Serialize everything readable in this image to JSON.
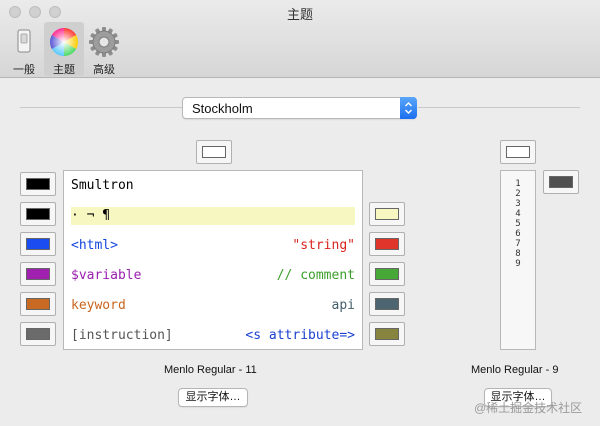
{
  "window": {
    "title": "主题"
  },
  "toolbar": {
    "items": [
      {
        "label": "一般",
        "icon": "switch-icon"
      },
      {
        "label": "主题",
        "icon": "color-wheel-icon"
      },
      {
        "label": "高级",
        "icon": "gear-icon"
      }
    ],
    "selected": "主题"
  },
  "theme": {
    "selected": "Stockholm"
  },
  "preview": {
    "lines": [
      {
        "left": "Smultron",
        "right": "",
        "left_color": "#000000",
        "right_color": "#000000"
      },
      {
        "left": "·  ¬  ¶",
        "right": "",
        "left_color": "#000000",
        "right_color": "#000000"
      },
      {
        "left": "<html>",
        "right": "\"string\"",
        "left_color": "#1447e0",
        "right_color": "#d9231f"
      },
      {
        "left": "$variable",
        "right": "// comment",
        "left_color": "#9a1fae",
        "right_color": "#3b9e2a"
      },
      {
        "left": "keyword",
        "right": "api",
        "left_color": "#c9651f",
        "right_color": "#44606b"
      },
      {
        "left": "[instruction]",
        "right": "<s attribute=>",
        "left_color": "#555555",
        "right_color": "#1a3fd0"
      }
    ],
    "highlight_color": "#f7f7c1"
  },
  "colors": {
    "left_wells": [
      "#000000",
      "#000000",
      "#1b4cf2",
      "#a020b0",
      "#c96a22",
      "#6b6b6b"
    ],
    "right_wells": [
      "#f7f7c1",
      "#e0352b",
      "#48a837",
      "#4c6570",
      "#86843e"
    ],
    "top_well": "#ffffff",
    "gutter_top_well": "#ffffff",
    "gutter_right_well": "#505050"
  },
  "editor_font": {
    "label": "Menlo Regular - 11",
    "button": "显示字体…"
  },
  "gutter": {
    "numbers": [
      "1",
      "2",
      "3",
      "4",
      "5",
      "6",
      "7",
      "8",
      "9"
    ],
    "font_label": "Menlo Regular - 9",
    "button": "显示字体…"
  },
  "watermark": "@稀土掘金技术社区"
}
